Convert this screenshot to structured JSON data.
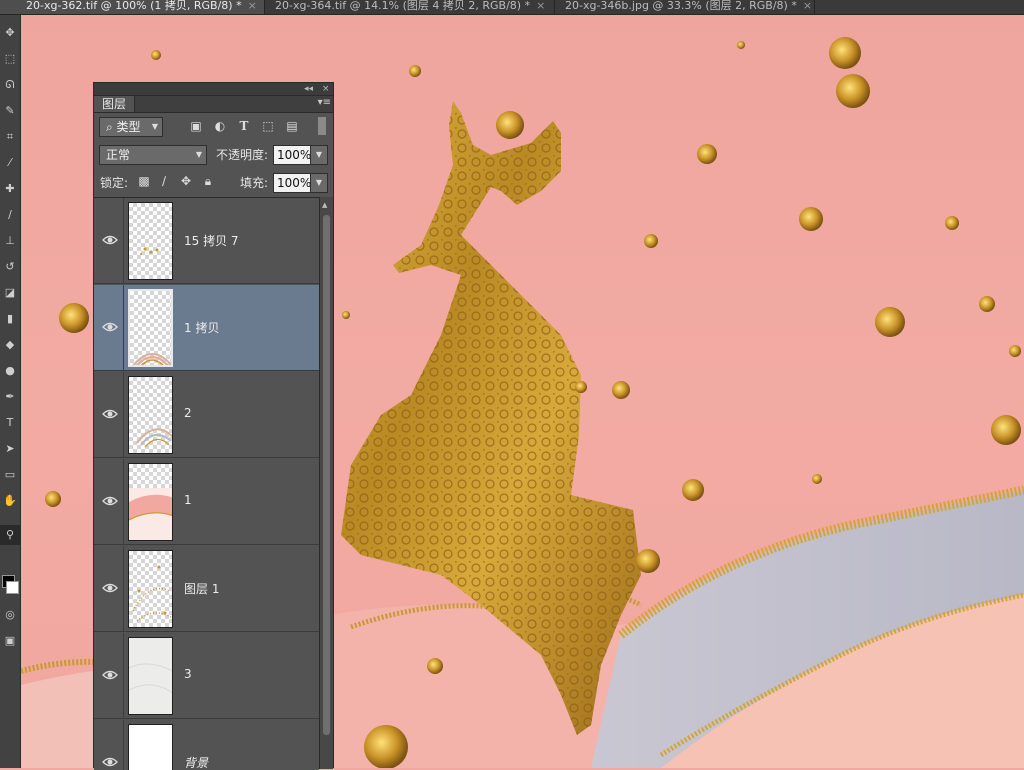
{
  "tabs": [
    {
      "title": "20-xg-362.tif @ 100% (1 拷贝, RGB/8) *",
      "active": true
    },
    {
      "title": "20-xg-364.tif @ 14.1% (图层 4 拷贝 2, RGB/8) *",
      "active": false
    },
    {
      "title": "20-xg-346b.jpg @ 33.3% (图层 2, RGB/8) *",
      "active": false
    }
  ],
  "tab_close_glyph": "×",
  "panel": {
    "collapse_glyph": "◂◂",
    "close_glyph": "×",
    "tab_label": "图层",
    "menu_glyph": "▾≡",
    "filter": {
      "kind_label": "类型",
      "icons": [
        "image-filter-icon",
        "adjustment-filter-icon",
        "type-filter-icon",
        "shape-filter-icon",
        "smart-object-filter-icon"
      ]
    },
    "blend_mode": "正常",
    "opacity_label": "不透明度:",
    "opacity_value": "100%",
    "lock_label": "锁定:",
    "fill_label": "填充:",
    "fill_value": "100%",
    "layers": [
      {
        "name": "15 拷贝 7",
        "selected": false,
        "visible": true,
        "italic": false,
        "locked": false,
        "thumb": "checker-dots"
      },
      {
        "name": "1 拷贝",
        "selected": true,
        "visible": true,
        "italic": false,
        "locked": false,
        "thumb": "checker-rainbow"
      },
      {
        "name": "2",
        "selected": false,
        "visible": true,
        "italic": false,
        "locked": false,
        "thumb": "checker-rainbow2"
      },
      {
        "name": "1",
        "selected": false,
        "visible": true,
        "italic": false,
        "locked": false,
        "thumb": "pink-wave"
      },
      {
        "name": "图层 1",
        "selected": false,
        "visible": true,
        "italic": false,
        "locked": false,
        "thumb": "checker-gold"
      },
      {
        "name": "3",
        "selected": false,
        "visible": true,
        "italic": false,
        "locked": false,
        "thumb": "marble"
      },
      {
        "name": "背景",
        "selected": false,
        "visible": true,
        "italic": true,
        "locked": true,
        "thumb": "white"
      }
    ]
  },
  "colors": {
    "canvas_bg": "#f0a8a0",
    "gold": "#c99a2e",
    "panel_bg": "#535353",
    "selected_layer": "#6a7b90"
  }
}
